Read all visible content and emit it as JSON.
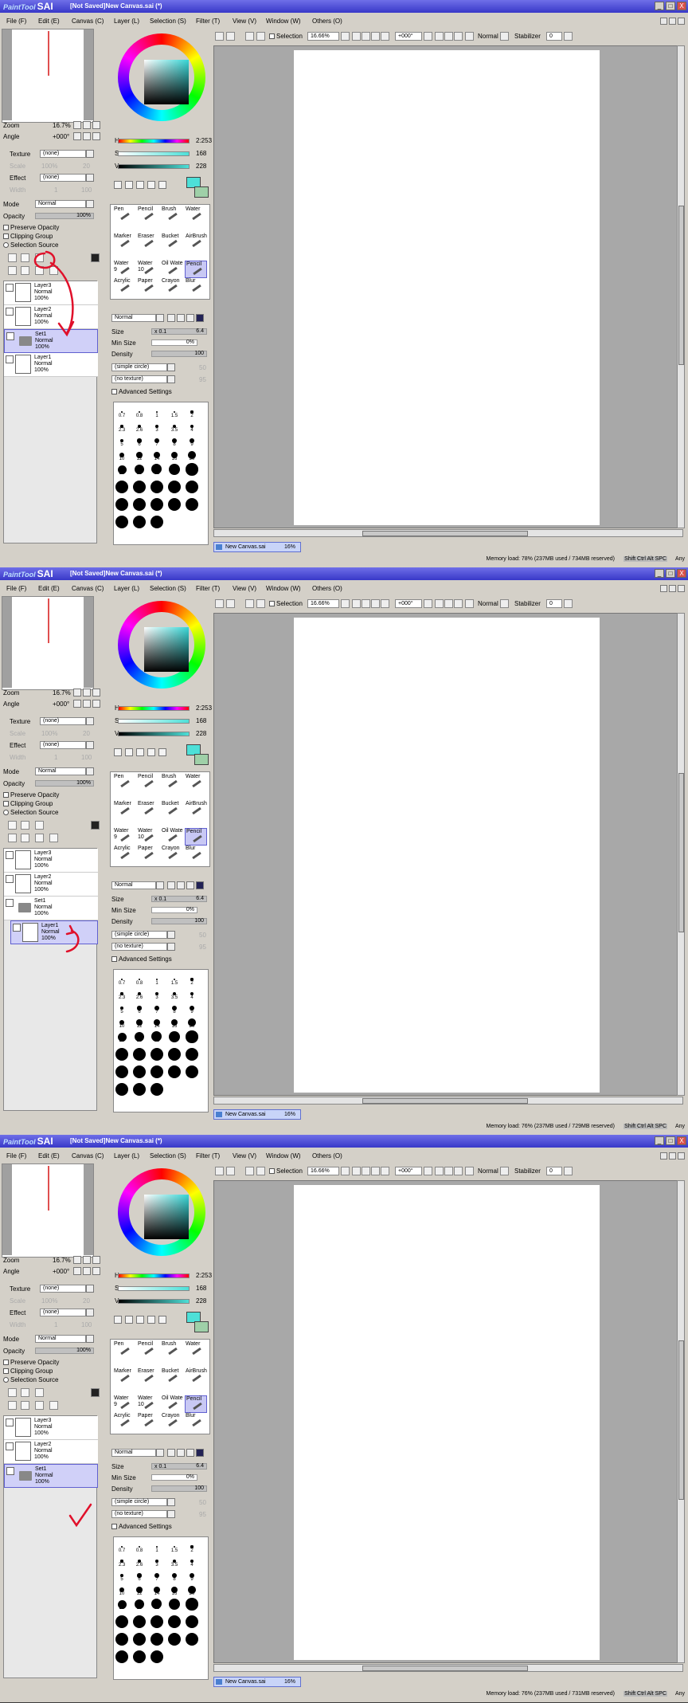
{
  "app": {
    "logo_small": "PaintTool",
    "logo_big": "SAI",
    "window_title": "[Not Saved]New Canvas.sai (*)"
  },
  "window_buttons": {
    "min": "_",
    "max": "□",
    "close": "X"
  },
  "menus": [
    "File (F)",
    "Edit (E)",
    "Canvas (C)",
    "Layer (L)",
    "Selection (S)",
    "Filter (T)",
    "View (V)",
    "Window (W)",
    "Others (O)"
  ],
  "navigator": {
    "zoom_label": "Zoom",
    "zoom_value": "16.7%",
    "angle_label": "Angle",
    "angle_value": "+000°"
  },
  "layer_props": {
    "texture_label": "Texture",
    "texture_value": "(none)",
    "scale_label": "Scale",
    "scale_value": "100%",
    "scale_num": "20",
    "effect_label": "Effect",
    "effect_value": "(none)",
    "width_label": "Width",
    "width_num": "1",
    "width_max": "100",
    "mode_label": "Mode",
    "mode_value": "Normal",
    "opacity_label": "Opacity",
    "opacity_value": "100%",
    "preserve_opacity": "Preserve Opacity",
    "clipping_group": "Clipping Group",
    "selection_source": "Selection Source"
  },
  "color": {
    "h_label": "H",
    "h_value": "2:253",
    "s_label": "S",
    "s_value": "168",
    "v_label": "V",
    "v_value": "228",
    "primary": "#4de0d8",
    "secondary": "#9fd0a8"
  },
  "tools": {
    "row1": [
      "Pen",
      "Pencil",
      "Brush",
      "Water"
    ],
    "row2": [
      "Marker",
      "Eraser",
      "Bucket",
      "AirBrush"
    ],
    "row3": [
      "Water",
      "Water",
      "Oil Wate",
      "Pencil"
    ],
    "row3_sizes": [
      "9",
      "10",
      "",
      ""
    ],
    "row4": [
      "Acrylic",
      "Paper",
      "Crayon",
      "Blur"
    ]
  },
  "brush": {
    "mode": "Normal",
    "size_label": "Size",
    "size_mult": "x 0.1",
    "size_value": "6.4",
    "minsize_label": "Min Size",
    "minsize_value": "0%",
    "density_label": "Density",
    "density_value": "100",
    "shape": "(simple circle)",
    "shape_num": "50",
    "texture": "(no texture)",
    "texture_num": "95",
    "advanced": "Advanced Settings"
  },
  "size_presets": [
    "0.7",
    "0.8",
    "1",
    "1.5",
    "2",
    "2.3",
    "2.6",
    "3",
    "3.5",
    "4",
    "5",
    "6",
    "7",
    "8",
    "9",
    "10",
    "12",
    "14",
    "16",
    "20",
    "25",
    "30",
    "35",
    "40",
    "50",
    "60",
    "70",
    "80",
    "100",
    "120",
    "160",
    "200",
    "250",
    "300",
    "350",
    "400",
    "450",
    "500"
  ],
  "toolbar": {
    "selection_label": "Selection",
    "zoom_value": "16.66%",
    "angle_value": "+000°",
    "mode_value": "Normal",
    "stabilizer_label": "Stabilizer",
    "stabilizer_value": "0"
  },
  "tab": {
    "label": "New Canvas.sai",
    "zoom": "16%"
  },
  "status_keys": "Shift Ctrl Alt SPC",
  "status_any": "Any",
  "panels": [
    {
      "memory": "Memory load: 78% (237MB used / 734MB reserved)",
      "layers": [
        {
          "name": "Layer3",
          "mode": "Normal",
          "opacity": "100%",
          "kind": "layer",
          "selected": false,
          "indent": false
        },
        {
          "name": "Layer2",
          "mode": "Normal",
          "opacity": "100%",
          "kind": "layer",
          "selected": false,
          "indent": false
        },
        {
          "name": "Set1",
          "mode": "Normal",
          "opacity": "100%",
          "kind": "folder",
          "selected": true,
          "indent": false
        },
        {
          "name": "Layer1",
          "mode": "Normal",
          "opacity": "100%",
          "kind": "layer",
          "selected": false,
          "indent": false
        }
      ]
    },
    {
      "memory": "Memory load: 76% (237MB used / 729MB reserved)",
      "layers": [
        {
          "name": "Layer3",
          "mode": "Normal",
          "opacity": "100%",
          "kind": "layer",
          "selected": false,
          "indent": false
        },
        {
          "name": "Layer2",
          "mode": "Normal",
          "opacity": "100%",
          "kind": "layer",
          "selected": false,
          "indent": false
        },
        {
          "name": "Set1",
          "mode": "Normal",
          "opacity": "100%",
          "kind": "folder",
          "selected": false,
          "indent": false
        },
        {
          "name": "Layer1",
          "mode": "Normal",
          "opacity": "100%",
          "kind": "layer",
          "selected": true,
          "indent": true
        }
      ]
    },
    {
      "memory": "Memory load: 76% (237MB used / 731MB reserved)",
      "layers": [
        {
          "name": "Layer3",
          "mode": "Normal",
          "opacity": "100%",
          "kind": "layer",
          "selected": false,
          "indent": false
        },
        {
          "name": "Layer2",
          "mode": "Normal",
          "opacity": "100%",
          "kind": "layer",
          "selected": false,
          "indent": false
        },
        {
          "name": "Set1",
          "mode": "Normal",
          "opacity": "100%",
          "kind": "folder",
          "selected": true,
          "indent": false
        }
      ]
    }
  ]
}
